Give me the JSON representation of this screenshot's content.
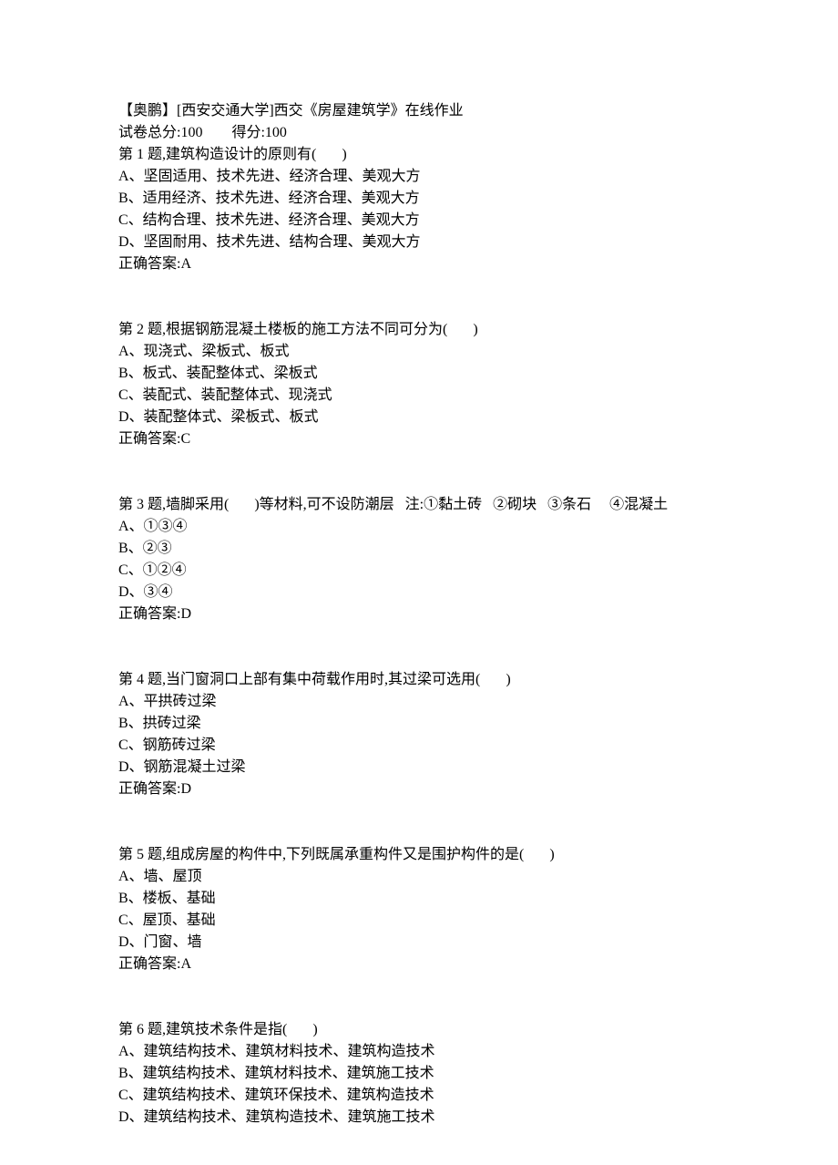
{
  "header": {
    "title": "【奥鹏】[西安交通大学]西交《房屋建筑学》在线作业",
    "scoreLabel": "试卷总分:100        得分:100"
  },
  "questions": [
    {
      "prompt": "第 1 题,建筑构造设计的原则有(       )",
      "options": [
        "A、坚固适用、技术先进、经济合理、美观大方",
        "B、适用经济、技术先进、经济合理、美观大方",
        "C、结构合理、技术先进、经济合理、美观大方",
        "D、坚固耐用、技术先进、结构合理、美观大方"
      ],
      "answer": "正确答案:A"
    },
    {
      "prompt": "第 2 题,根据钢筋混凝土楼板的施工方法不同可分为(       )",
      "options": [
        "A、现浇式、梁板式、板式",
        "B、板式、装配整体式、梁板式",
        "C、装配式、装配整体式、现浇式",
        "D、装配整体式、梁板式、板式"
      ],
      "answer": "正确答案:C"
    },
    {
      "prompt": "第 3 题,墙脚采用(       )等材料,可不设防潮层   注:①黏土砖   ②砌块   ③条石     ④混凝土",
      "options": [
        "A、①③④",
        "B、②③",
        "C、①②④",
        "D、③④"
      ],
      "answer": "正确答案:D"
    },
    {
      "prompt": "第 4 题,当门窗洞口上部有集中荷载作用时,其过梁可选用(       )",
      "options": [
        "A、平拱砖过梁",
        "B、拱砖过梁",
        "C、钢筋砖过梁",
        "D、钢筋混凝土过梁"
      ],
      "answer": "正确答案:D"
    },
    {
      "prompt": "第 5 题,组成房屋的构件中,下列既属承重构件又是围护构件的是(       )",
      "options": [
        "A、墙、屋顶",
        "B、楼板、基础",
        "C、屋顶、基础",
        "D、门窗、墙"
      ],
      "answer": "正确答案:A"
    },
    {
      "prompt": "第 6 题,建筑技术条件是指(       )",
      "options": [
        "A、建筑结构技术、建筑材料技术、建筑构造技术",
        "B、建筑结构技术、建筑材料技术、建筑施工技术",
        "C、建筑结构技术、建筑环保技术、建筑构造技术",
        "D、建筑结构技术、建筑构造技术、建筑施工技术"
      ],
      "answer": ""
    }
  ]
}
